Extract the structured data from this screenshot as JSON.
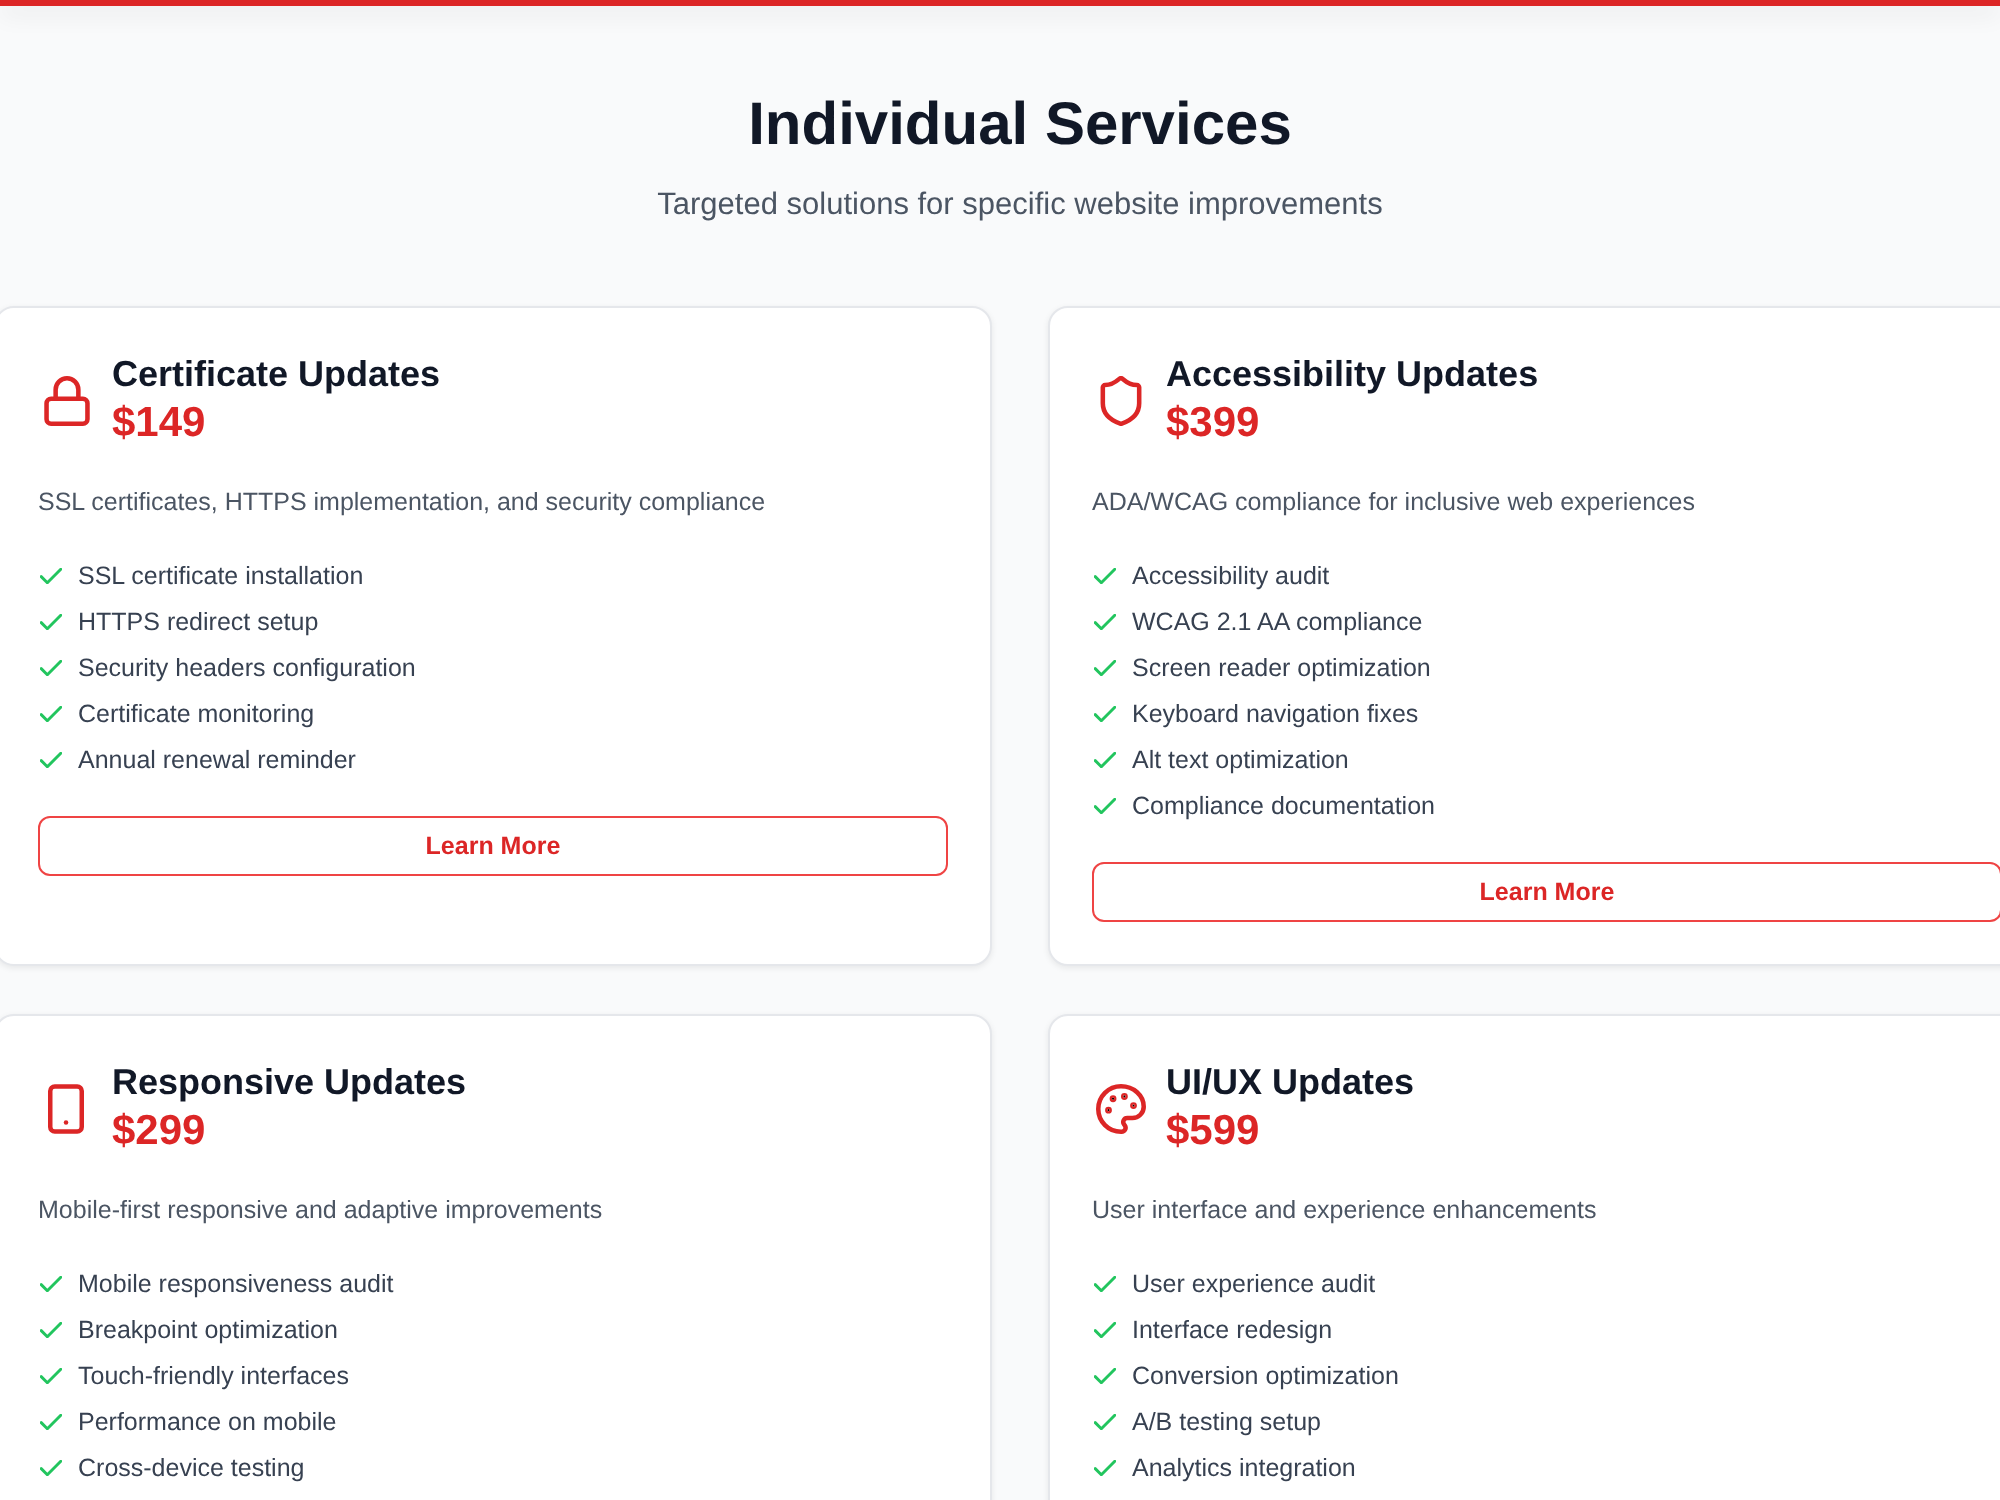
{
  "header": {
    "title": "Individual Services",
    "subtitle": "Targeted solutions for specific website improvements"
  },
  "services": [
    {
      "kind": "lock",
      "title": "Certificate Updates",
      "price": "$149",
      "description": "SSL certificates, HTTPS implementation, and security compliance",
      "features": [
        "SSL certificate installation",
        "HTTPS redirect setup",
        "Security headers configuration",
        "Certificate monitoring",
        "Annual renewal reminder"
      ],
      "button": "Learn More"
    },
    {
      "kind": "shield",
      "title": "Accessibility Updates",
      "price": "$399",
      "description": "ADA/WCAG compliance for inclusive web experiences",
      "features": [
        "Accessibility audit",
        "WCAG 2.1 AA compliance",
        "Screen reader optimization",
        "Keyboard navigation fixes",
        "Alt text optimization",
        "Compliance documentation"
      ],
      "button": "Learn More"
    },
    {
      "kind": "phone",
      "title": "Responsive Updates",
      "price": "$299",
      "description": "Mobile-first responsive and adaptive improvements",
      "features": [
        "Mobile responsiveness audit",
        "Breakpoint optimization",
        "Touch-friendly interfaces",
        "Performance on mobile",
        "Cross-device testing"
      ]
    },
    {
      "kind": "design",
      "title": "UI/UX Updates",
      "price": "$599",
      "description": "User interface and experience enhancements",
      "features": [
        "User experience audit",
        "Interface redesign",
        "Conversion optimization",
        "A/B testing setup",
        "Analytics integration"
      ]
    }
  ]
}
